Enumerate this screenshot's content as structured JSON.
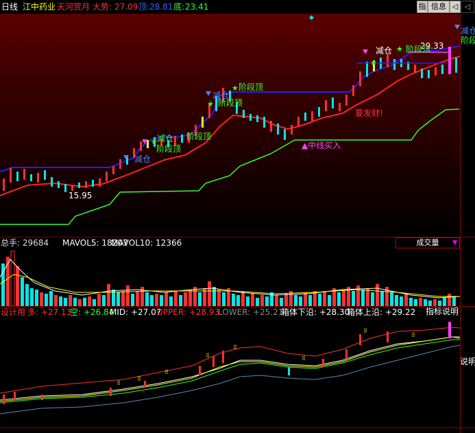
{
  "header": {
    "period": "日线",
    "stock_name": "江中药业",
    "indicator_name": "天河赏月",
    "trend_label": "大势:",
    "trend_value": "27.09",
    "top_label": "顶:",
    "top_value": "28.81",
    "bottom_label": "底:",
    "bottom_value": "23.41",
    "btn_zhi": "指",
    "btn_info": "信息",
    "btn_back": "◁"
  },
  "main_chart": {
    "annotations": {
      "low_price": "15.95",
      "high_price": "29.33",
      "jianceng_1": "减仓",
      "jianceng_2": "减仓",
      "jianceng_3": "减仓",
      "jianceng_4": "减仓",
      "jianceng_5": "减仓",
      "jieduan_1": "阶段顶",
      "jieduan_2": "阶段顶",
      "jieduan_3": "阶段顶",
      "jieduan_4": "阶段顶",
      "jieduan_5": "阶段顶",
      "jieduan_6": "阶段",
      "zhongxian_buy": "▲中线买入",
      "yaofacai": "要发财!"
    }
  },
  "volume_pane": {
    "label": "总手: 29684",
    "mavol5": "MAVOL5: 18207",
    "mavol10": "MAVOL10: 12366",
    "selector": "成交量"
  },
  "indicator_pane": {
    "name": "设计用",
    "duo": "多: +27.13",
    "kong": "空: +26.84",
    "mid": "MID: +27.07",
    "upper": "UPPER: +28.93",
    "lower": "LOWER: +25.21",
    "box_low": "箱体下沿: +28.30",
    "box_high": "箱体上沿: +29.22",
    "explain_btn": "指标说明",
    "explain_right": "说明"
  },
  "colors": {
    "up": "#ff3030",
    "down": "#00e8e8",
    "ma_red": "#ff2020",
    "ma_blue": "#2020ff",
    "ma_green": "#30ff30",
    "magenta": "#ff40ff"
  }
}
